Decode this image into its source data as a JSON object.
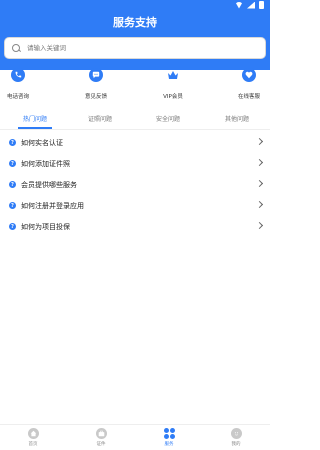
{
  "header": {
    "title": "服务支持"
  },
  "search": {
    "placeholder": "请输入关键词"
  },
  "quick_links": [
    {
      "label": "电话咨询",
      "icon": "phone-icon"
    },
    {
      "label": "意见反馈",
      "icon": "chat-icon"
    },
    {
      "label": "VIP会员",
      "icon": "crown-icon"
    },
    {
      "label": "在线客服",
      "icon": "heart-icon"
    }
  ],
  "tabs": [
    {
      "label": "热门问题",
      "active": true
    },
    {
      "label": "证照问题",
      "active": false
    },
    {
      "label": "安全问题",
      "active": false
    },
    {
      "label": "其他问题",
      "active": false
    }
  ],
  "faq": [
    {
      "text": "如何实名认证"
    },
    {
      "text": "如何添加证件照"
    },
    {
      "text": "会员提供哪些服务"
    },
    {
      "text": "如何注册并登录应用"
    },
    {
      "text": "如何为项目投保"
    }
  ],
  "bottom_nav": [
    {
      "label": "首页",
      "active": false
    },
    {
      "label": "证件",
      "active": false
    },
    {
      "label": "服务",
      "active": true
    },
    {
      "label": "我的",
      "active": false
    }
  ],
  "colors": {
    "accent": "#2f7cf6"
  }
}
